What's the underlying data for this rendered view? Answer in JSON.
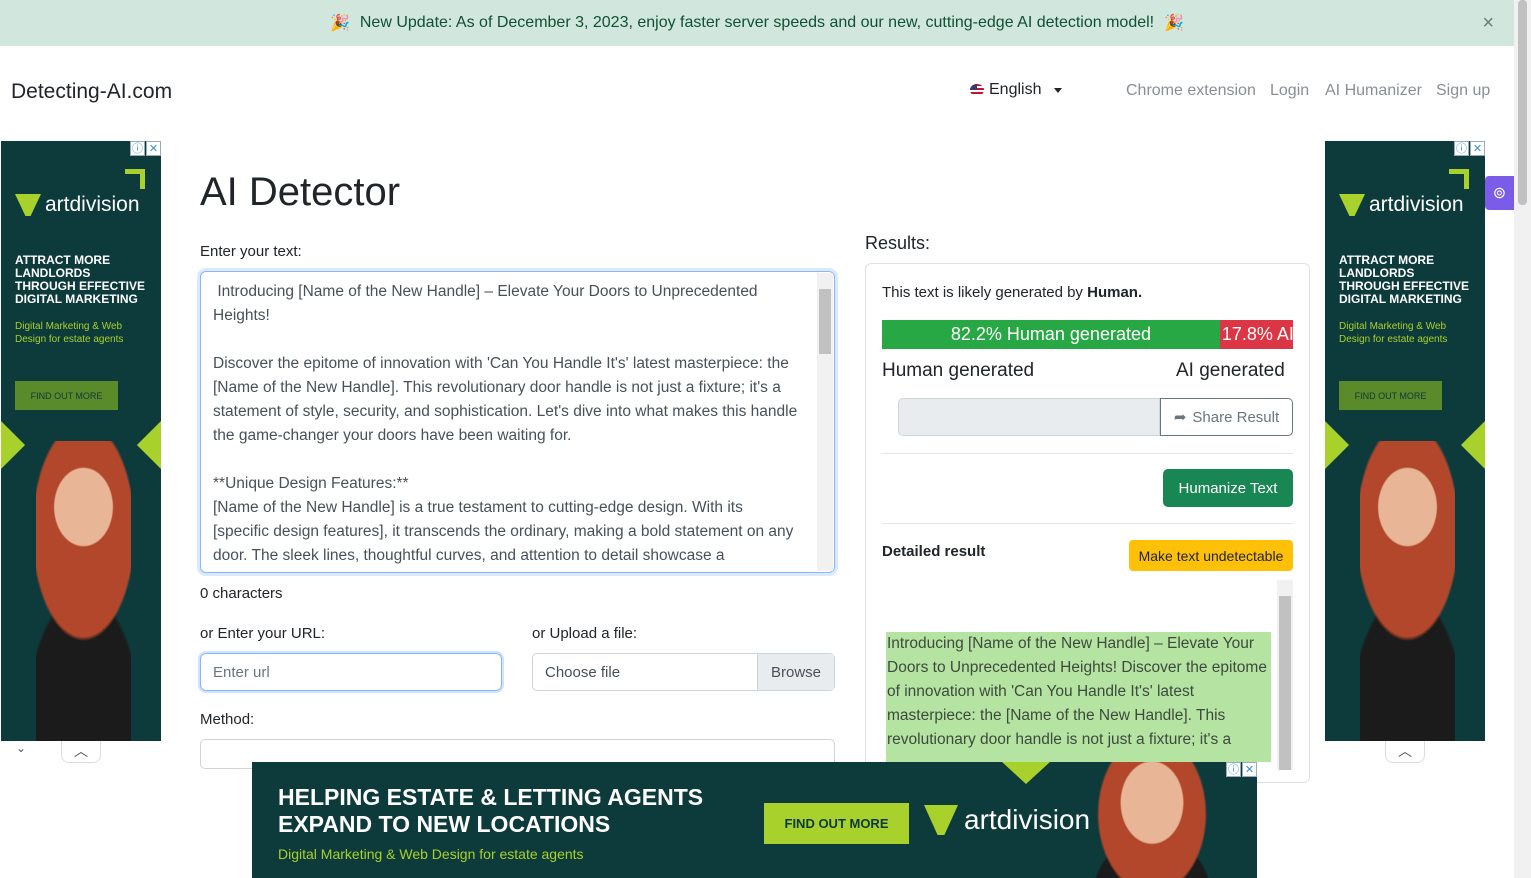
{
  "banner": {
    "text": "New Update: As of December 3, 2023, enjoy faster server speeds and our new, cutting-edge AI detection model!",
    "emoji": "🎉",
    "close": "×"
  },
  "header": {
    "brand": "Detecting-AI.com",
    "language": "English",
    "nav": [
      "Chrome extension",
      "Login",
      "AI Humanizer",
      "Sign up"
    ]
  },
  "main": {
    "title": "AI Detector",
    "text_label": "Enter your text:",
    "text_value": " Introducing [Name of the New Handle] – Elevate Your Doors to Unprecedented Heights!\n\nDiscover the epitome of innovation with 'Can You Handle It's' latest masterpiece: the [Name of the New Handle]. This revolutionary door handle is not just a fixture; it's a statement of style, security, and sophistication. Let's dive into what makes this handle the game-changer your doors have been waiting for.\n\n**Unique Design Features:**\n[Name of the New Handle] is a true testament to cutting-edge design. With its [specific design features], it transcends the ordinary, making a bold statement on any door. The sleek lines, thoughtful curves, and attention to detail showcase a",
    "char_count": "0 characters",
    "url_label": "or Enter your URL:",
    "url_placeholder": "Enter url",
    "file_label": "or Upload a file:",
    "file_placeholder": "Choose file",
    "browse": "Browse",
    "method_label": "Method:"
  },
  "results": {
    "title": "Results:",
    "likely_prefix": "This text is likely generated by",
    "likely_value": "Human.",
    "human_pct": 82.2,
    "human_text": "82.2% Human generated",
    "ai_text": "17.8% AI",
    "human_label": "Human generated",
    "ai_label": "AI generated",
    "share": "Share Result",
    "humanize": "Humanize Text",
    "detailed": "Detailed result",
    "undetectable": "Make text undetectable",
    "detail_text": "Introducing [Name of the New Handle] – Elevate Your Doors to Unprecedented Heights! Discover the epitome of innovation with 'Can You Handle It's' latest masterpiece: the [Name of the New Handle]. This revolutionary door handle is not just a fixture; it's a"
  },
  "ads": {
    "brand": "artdivision",
    "side_headline": "ATTRACT MORE LANDLORDS THROUGH EFFECTIVE DIGITAL MARKETING",
    "side_sub": "Digital Marketing & Web Design for estate agents",
    "cta": "FIND OUT MORE",
    "bottom_headline_1": "HELPING ESTATE & LETTING AGENTS",
    "bottom_headline_2": "EXPAND TO NEW LOCATIONS",
    "bottom_sub": "Digital Marketing & Web Design for estate agents",
    "info": "ⓘ",
    "close": "✕"
  },
  "colors": {
    "human": "#28a745",
    "ai": "#dc3545",
    "humanize": "#198754",
    "undetectable": "#ffc107"
  }
}
